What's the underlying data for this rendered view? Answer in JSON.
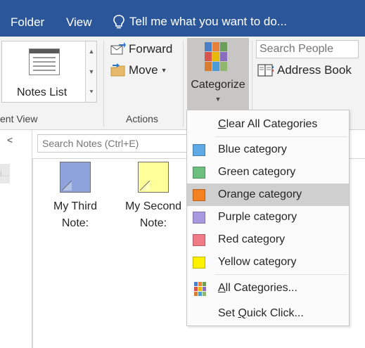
{
  "tabs": {
    "folder": "Folder",
    "view": "View",
    "tell_me": "Tell me what you want to do..."
  },
  "ribbon": {
    "current_view": {
      "gallery_item": "Notes List",
      "group_label": "ent View"
    },
    "actions": {
      "forward": "Forward",
      "move": "Move",
      "group_label": "Actions"
    },
    "tags": {
      "categorize": "Categorize"
    },
    "find": {
      "search_placeholder": "Search People",
      "address_book": "Address Book"
    }
  },
  "body": {
    "search_notes_placeholder": "Search Notes (Ctrl+E)",
    "left_pane_partial": "i...",
    "notes": [
      {
        "line1": "My Third",
        "line2": "Note:",
        "color": "#8ea3db"
      },
      {
        "line1": "My Second",
        "line2": "Note:",
        "color": "#ffff99"
      }
    ]
  },
  "menu": {
    "clear_all_pre": "",
    "clear_all_key": "C",
    "clear_all_post": "lear All Categories",
    "categories": [
      {
        "label": "Blue category",
        "color": "#5ea8e6",
        "highlighted": false
      },
      {
        "label": "Green category",
        "color": "#6cbf7f",
        "highlighted": false
      },
      {
        "label": "Orange category",
        "color": "#f58220",
        "highlighted": true
      },
      {
        "label": "Purple category",
        "color": "#a898e0",
        "highlighted": false
      },
      {
        "label": "Red category",
        "color": "#f07a86",
        "highlighted": false
      },
      {
        "label": "Yellow category",
        "color": "#fff200",
        "highlighted": false
      }
    ],
    "all_categories_key": "A",
    "all_categories_post": "ll Categories...",
    "set_quick_pre": "Set ",
    "set_quick_key": "Q",
    "set_quick_post": "uick Click..."
  },
  "colors": {
    "ribbon_tab_bg": "#2b579a",
    "selected_button_bg": "#c8c6c4",
    "menu_highlight": "#cfcfcf"
  }
}
